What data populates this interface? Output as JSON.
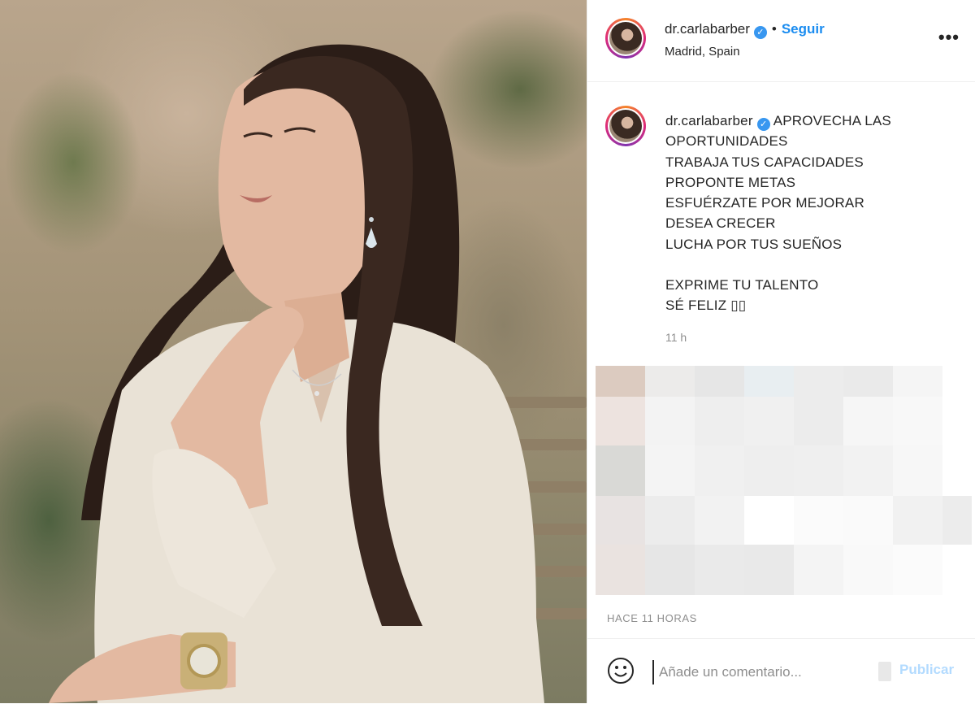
{
  "post": {
    "username": "dr.carlabarber",
    "follow_label": "Seguir",
    "location": "Madrid, Spain",
    "more_label": "•••"
  },
  "caption": {
    "username": "dr.carlabarber",
    "lines": [
      "APROVECHA LAS",
      "OPORTUNIDADES",
      "TRABAJA TUS CAPACIDADES",
      "PROPONTE METAS",
      "ESFUÉRZATE POR MEJORAR",
      "DESEA CRECER",
      "LUCHA POR TUS SUEÑOS",
      "",
      "EXPRIME TU TALENTO",
      "SÉ FELIZ ▯▯"
    ],
    "time": "11 h"
  },
  "posted_time": "HACE 11 HORAS",
  "comment": {
    "placeholder": "Añade un comentario...",
    "publish_label": "Publicar"
  },
  "colors": {
    "accent": "#1a8cf0",
    "publish_disabled": "#b3dbff",
    "muted": "#8e8e8e",
    "verified": "#3897f0"
  },
  "icons": {
    "verified": "verified-badge-icon",
    "emoji": "smiley-icon",
    "more": "more-options-icon"
  }
}
